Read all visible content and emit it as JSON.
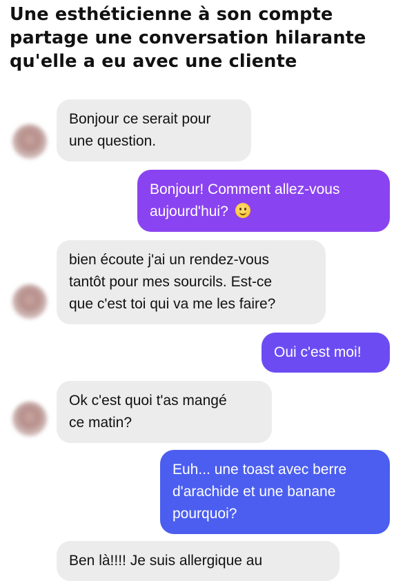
{
  "headline": {
    "line1": "Une esthéticienne à son compte",
    "line2": "partage une conversation hilarante",
    "line3": "qu'elle a eu avec une cliente"
  },
  "conversation": {
    "messages": [
      {
        "sender": "client",
        "lines": [
          "Bonjour ce serait pour",
          "une question."
        ]
      },
      {
        "sender": "esthéticienne",
        "lines": [
          "Bonjour! Comment allez-vous",
          "aujourd'hui?"
        ],
        "emoji": "slightly-smiling-face-icon"
      },
      {
        "sender": "client",
        "lines": [
          "bien écoute j'ai un rendez-vous",
          "tantôt pour mes sourcils. Est-ce",
          "que c'est toi qui va me les faire?"
        ]
      },
      {
        "sender": "esthéticienne",
        "lines": [
          "Oui c'est moi!"
        ]
      },
      {
        "sender": "client",
        "lines": [
          "Ok c'est quoi t'as mangé",
          "ce matin?"
        ]
      },
      {
        "sender": "esthéticienne",
        "lines": [
          "Euh... une toast avec berre",
          "d'arachide et une banane",
          "pourquoi?"
        ]
      },
      {
        "sender": "client",
        "lines": [
          "Ben là!!!! Je suis allergique au"
        ]
      }
    ]
  },
  "colors": {
    "incoming_bubble": "#ececec",
    "outgoing_bubble_1": "#8a43f0",
    "outgoing_bubble_2": "#6c4cf2",
    "outgoing_bubble_3": "#4b5ef0"
  }
}
